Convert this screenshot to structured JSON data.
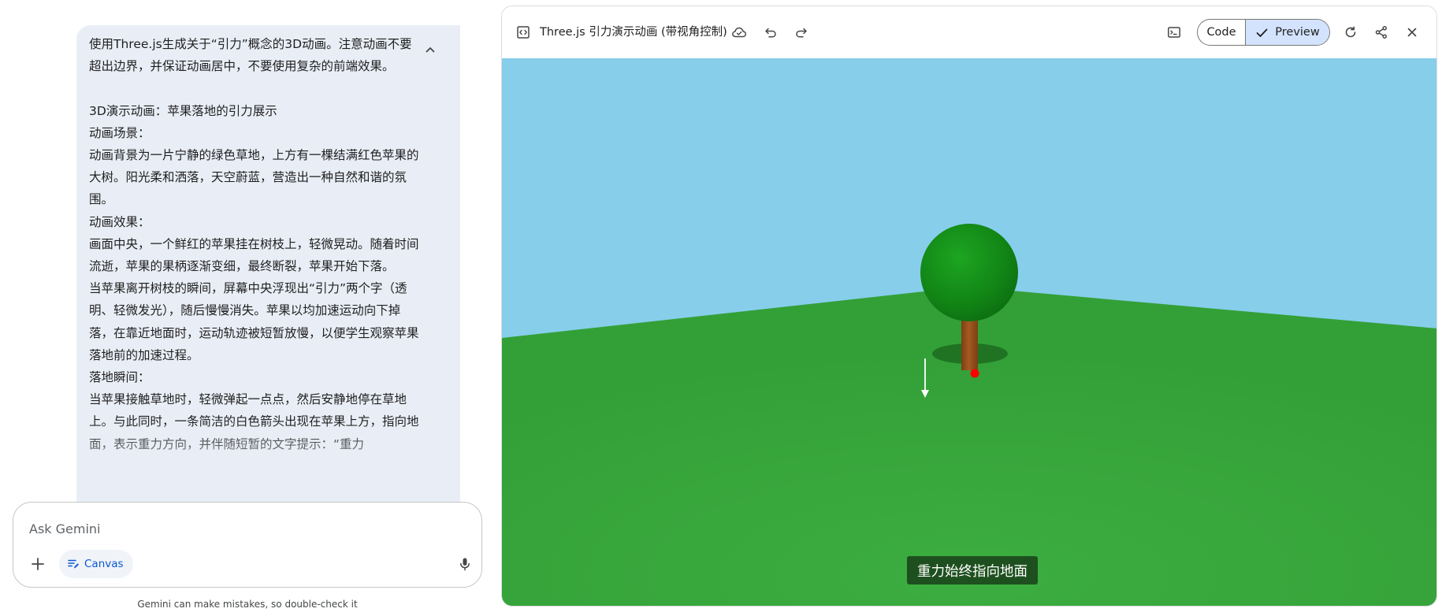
{
  "chat": {
    "prompt_text": "使用Three.js生成关于“引力”概念的3D动画。注意动画不要超出边界，并保证动画居中，不要使用复杂的前端效果。\n\n3D演示动画：苹果落地的引力展示\n动画场景：\n动画背景为一片宁静的绿色草地，上方有一棵结满红色苹果的大树。阳光柔和洒落，天空蔚蓝，营造出一种自然和谐的氛围。\n动画效果：\n画面中央，一个鲜红的苹果挂在树枝上，轻微晃动。随着时间流逝，苹果的果柄逐渐变细，最终断裂，苹果开始下落。\n当苹果离开树枝的瞬间，屏幕中央浮现出“引力”两个字（透明、轻微发光），随后慢慢消失。苹果以均加速运动向下掉落，在靠近地面时，运动轨迹被短暂放慢，以便学生观察苹果落地前的加速过程。\n落地瞬间：\n当苹果接触草地时，轻微弹起一点点，然后安静地停在草地上。与此同时，一条简洁的白色箭头出现在苹果上方，指向地面，表示重力方向，并伴随短暂的文字提示：“重力",
    "collapse_icon": "chevron-up-icon",
    "input_placeholder": "Ask Gemini",
    "add_icon": "plus-icon",
    "canvas_chip_label": "Canvas",
    "canvas_chip_icon": "canvas-edit-icon",
    "mic_icon": "mic-icon",
    "disclaimer": "Gemini can make mistakes, so double-check it"
  },
  "canvas": {
    "title": "Three.js 引力演示动画 (带视角控制)",
    "title_icon": "code-file-icon",
    "toolbar_icons": [
      "cloud-save-icon",
      "undo-icon",
      "redo-icon",
      "console-icon",
      "refresh-icon",
      "share-icon",
      "close-icon"
    ],
    "code_label": "Code",
    "preview_label": "Preview",
    "preview_selected": true,
    "scene_caption": "重力始终指向地面"
  },
  "colors": {
    "sky": "#87ceeb",
    "grass": "#36a33a",
    "foliage": "#138d17",
    "trunk": "#9a521f",
    "apple": "#ff0000",
    "bubble": "#e9eef6",
    "accent": "#0b57d0",
    "preview_bg": "#d3e3fd"
  }
}
